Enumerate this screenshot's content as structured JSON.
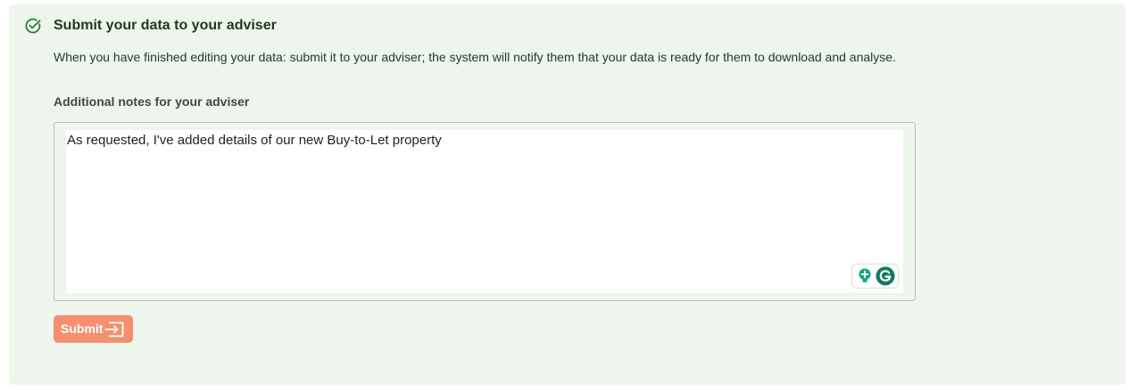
{
  "section": {
    "title": "Submit your data to your adviser",
    "description": "When you have finished editing your data: submit it to your adviser; the system will notify them that your data is ready for them to download and analyse.",
    "status_icon": "check-circle-icon"
  },
  "notes": {
    "label": "Additional notes for your adviser",
    "value": "As requested, I've added details of our new Buy-to-Let property"
  },
  "assistant": {
    "icons": [
      "lightbulb-icon",
      "grammarly-g-icon"
    ]
  },
  "submit": {
    "label": "Submit",
    "icon": "enter-arrow-icon"
  },
  "colors": {
    "panel_bg": "#edf5ec",
    "accent_green": "#2e7d32",
    "button_bg": "#f48f70"
  }
}
